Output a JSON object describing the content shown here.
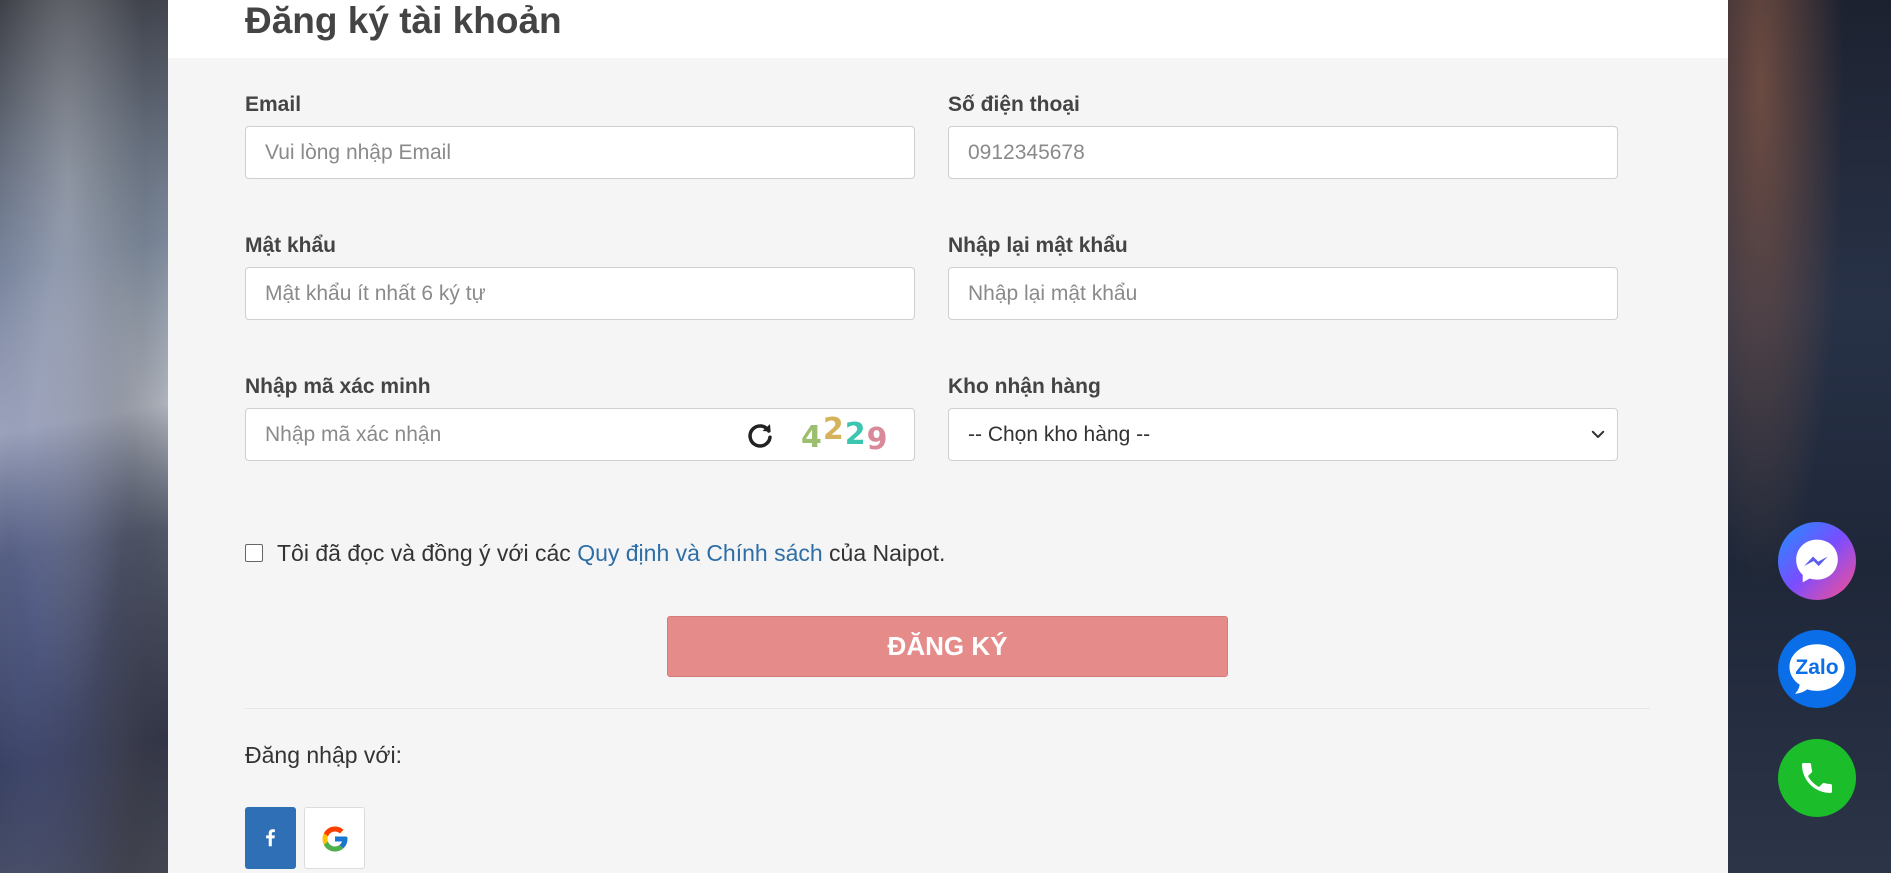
{
  "form": {
    "title": "Đăng ký tài khoản",
    "email": {
      "label": "Email",
      "placeholder": "Vui lòng nhập Email"
    },
    "phone": {
      "label": "Số điện thoại",
      "placeholder": "0912345678"
    },
    "password": {
      "label": "Mật khẩu",
      "placeholder": "Mật khẩu ít nhất 6 ký tự"
    },
    "confirm_password": {
      "label": "Nhập lại mật khẩu",
      "placeholder": "Nhập lại mật khẩu"
    },
    "captcha": {
      "label": "Nhập mã xác minh",
      "placeholder": "Nhập mã xác nhận",
      "code": [
        "4",
        "2",
        "2",
        "9"
      ],
      "code_colors": [
        "#9bbf6e",
        "#d6b25a",
        "#3cc6b0",
        "#d98a9a"
      ]
    },
    "warehouse": {
      "label": "Kho nhận hàng",
      "selected": "-- Chọn kho hàng --"
    },
    "agree": {
      "text_before": "Tôi đã đọc và đồng ý với các ",
      "link": "Quy định và Chính sách",
      "text_after": " của Naipot."
    },
    "register_button": "ĐĂNG KÝ",
    "login_with": "Đăng nhập với:"
  },
  "floating": {
    "zalo_label": "Zalo"
  },
  "colors": {
    "register_button": "#e58c8a",
    "link": "#2d6ea7",
    "facebook": "#2f6fb5",
    "phone": "#1bbd2a"
  },
  "icons": [
    "refresh-icon",
    "chevron-down-icon",
    "facebook-icon",
    "google-icon",
    "messenger-icon",
    "zalo-icon",
    "phone-icon"
  ]
}
